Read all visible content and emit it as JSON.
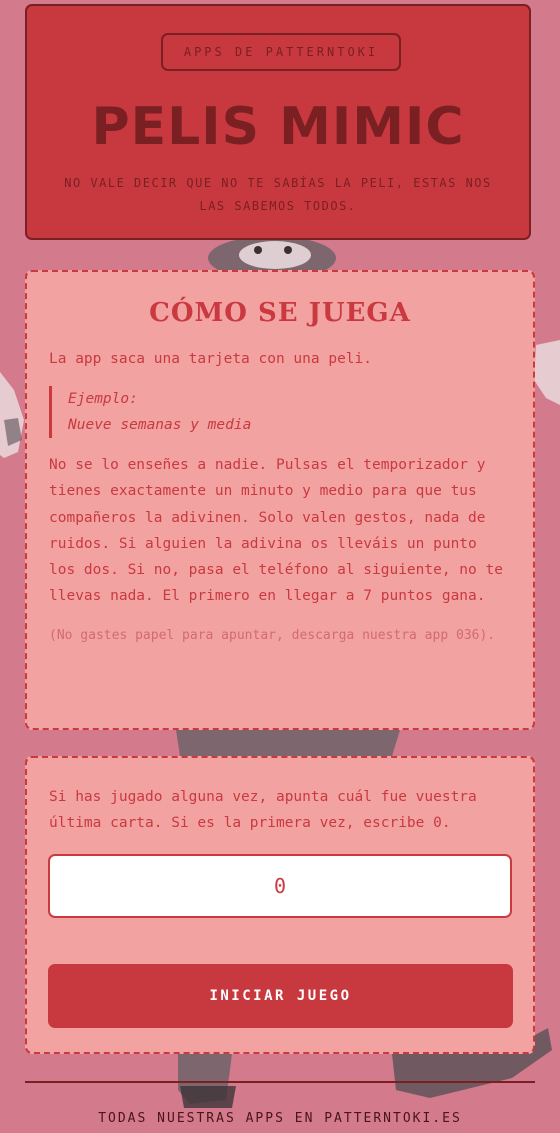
{
  "header": {
    "badge": "APPS DE PATTERNTOKI",
    "title": "PELIS MIMIC",
    "subtitle": "NO VALE DECIR QUE NO TE SABÍAS LA PELI, ESTAS NOS LAS SABEMOS TODOS."
  },
  "rules": {
    "title": "CÓMO SE JUEGA",
    "intro": "La app saca una tarjeta con una peli.",
    "example_label": "Ejemplo:",
    "example_value": "Nueve semanas y media",
    "body": "No se lo enseñes a nadie. Pulsas el temporizador y tienes exactamente un minuto y medio para que tus compañeros la adivinen. Solo valen gestos, nada de ruidos. Si alguien la adivina os lleváis un punto los dos. Si no, pasa el teléfono al siguiente, no te llevas nada. El primero en llegar a 7 puntos gana.",
    "note": "(No gastes papel para apuntar, descarga nuestra app 036)."
  },
  "game": {
    "prompt": "Si has jugado alguna vez, apunta cuál fue vuestra última carta. Si es la primera vez, escribe 0.",
    "last_card_value": "0",
    "start_label": "INICIAR JUEGO"
  },
  "footer": {
    "link_text": "TODAS NUESTRAS APPS EN PATTERNTOKI.ES"
  },
  "colors": {
    "background": "#d37a8d",
    "brand_red": "#c8393f",
    "dark_red": "#7a1f22",
    "card_pink": "#f2a3a1"
  },
  "background_image": {
    "icon": "mime-figure-photo"
  }
}
